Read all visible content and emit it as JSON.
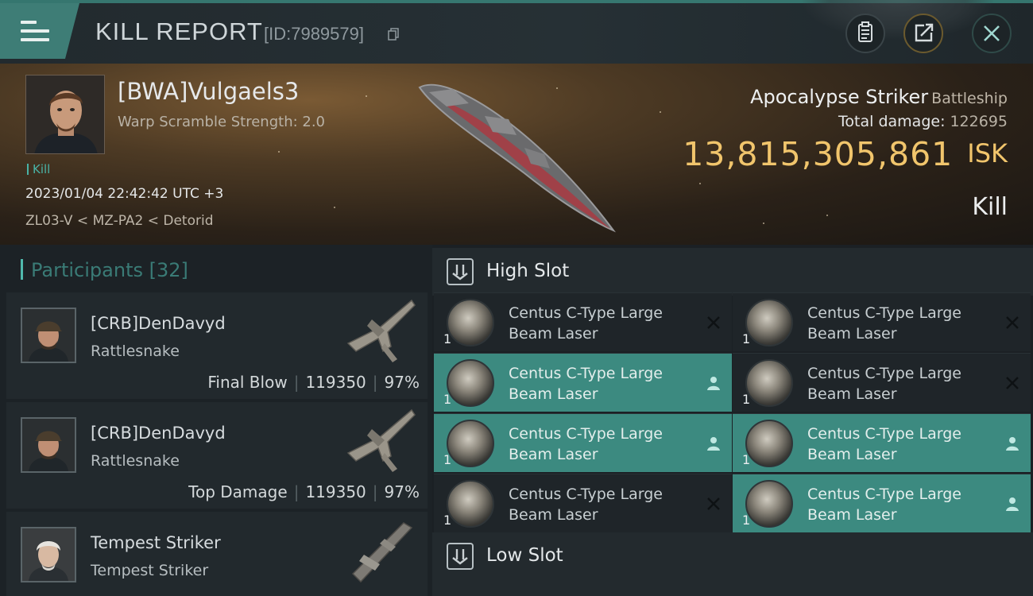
{
  "header": {
    "title": "KILL REPORT",
    "report_id": "[ID:7989579]",
    "icons": {
      "menu": "hamburger-menu-icon",
      "copy": "copy-icon",
      "clipboard": "clipboard-icon",
      "share": "share-icon",
      "close": "close-icon"
    }
  },
  "victim": {
    "pilot_name": "[BWA]Vulgaels3",
    "warp_scramble": "Warp Scramble Strength: 2.0",
    "tag": "Kill",
    "timestamp": "2023/01/04 22:42:42 UTC +3",
    "location": "ZL03-V < MZ-PA2 < Detorid",
    "ship_name": "Apocalypse Striker",
    "ship_class": "Battleship",
    "total_damage_label": "Total damage:",
    "total_damage": "122695",
    "isk_value": "13,815,305,861",
    "isk_unit": "ISK",
    "result": "Kill"
  },
  "participants": {
    "header": "Participants [32]",
    "items": [
      {
        "name": "[CRB]DenDavyd",
        "ship": "Rattlesnake",
        "role": "Final Blow",
        "damage": "119350",
        "percent": "97%"
      },
      {
        "name": "[CRB]DenDavyd",
        "ship": "Rattlesnake",
        "role": "Top Damage",
        "damage": "119350",
        "percent": "97%"
      },
      {
        "name": "Tempest Striker",
        "ship": "Tempest Striker",
        "role": "",
        "damage": "",
        "percent": ""
      }
    ]
  },
  "slots": {
    "high": {
      "label": "High Slot",
      "modules": [
        {
          "name": "Centus C-Type Large Beam Laser",
          "qty": "1",
          "status": "destroyed"
        },
        {
          "name": "Centus C-Type Large Beam Laser",
          "qty": "1",
          "status": "destroyed"
        },
        {
          "name": "Centus C-Type Large Beam Laser",
          "qty": "1",
          "status": "dropped"
        },
        {
          "name": "Centus C-Type Large Beam Laser",
          "qty": "1",
          "status": "destroyed"
        },
        {
          "name": "Centus C-Type Large Beam Laser",
          "qty": "1",
          "status": "dropped"
        },
        {
          "name": "Centus C-Type Large Beam Laser",
          "qty": "1",
          "status": "dropped"
        },
        {
          "name": "Centus C-Type Large Beam Laser",
          "qty": "1",
          "status": "destroyed"
        },
        {
          "name": "Centus C-Type Large Beam Laser",
          "qty": "1",
          "status": "dropped"
        }
      ]
    },
    "low": {
      "label": "Low Slot"
    }
  },
  "colors": {
    "accent": "#3c8a80",
    "isk": "#f1c56c",
    "teal_text": "#49b3a6"
  }
}
